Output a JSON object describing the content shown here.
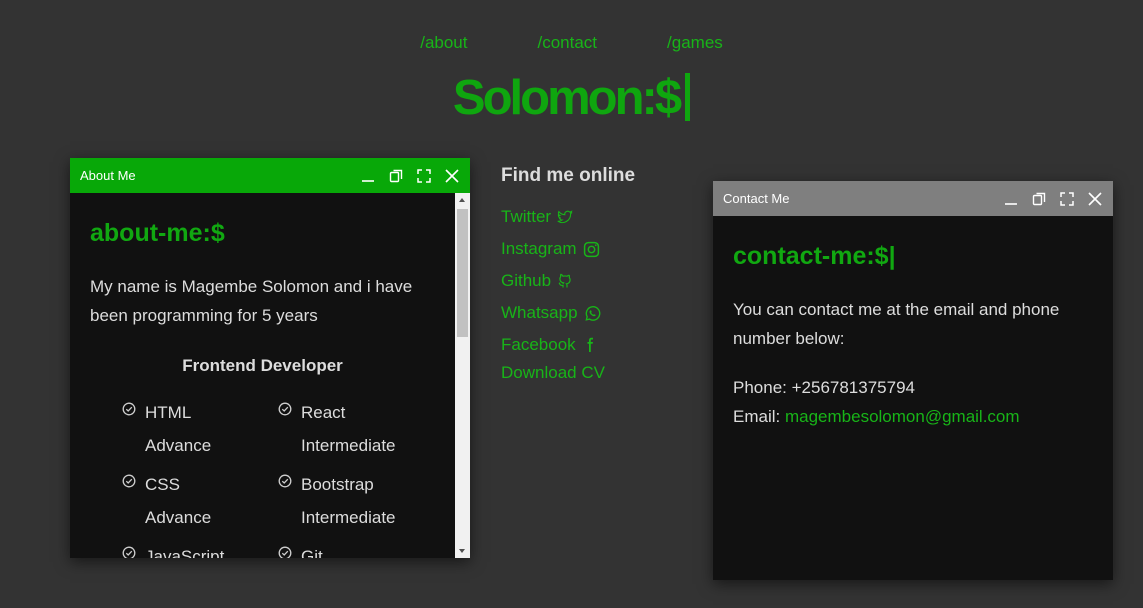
{
  "nav": {
    "about": "/about",
    "contact": "/contact",
    "games": "/games"
  },
  "brand": {
    "text": "Solomon:$"
  },
  "about_window": {
    "title": "About Me",
    "heading": "about-me:$",
    "paragraph": "My name is Magembe Solomon and i have been programming for 5 years",
    "role": "Frontend Developer",
    "skills": [
      {
        "name": "HTML",
        "level": "Advance"
      },
      {
        "name": "React",
        "level": "Intermediate"
      },
      {
        "name": "CSS",
        "level": "Advance"
      },
      {
        "name": "Bootstrap",
        "level": "Intermediate"
      },
      {
        "name": "JavaScript",
        "level": ""
      },
      {
        "name": "Git",
        "level": ""
      }
    ]
  },
  "find_online": {
    "heading": "Find me online",
    "links": [
      {
        "label": "Twitter",
        "icon": "twitter-icon"
      },
      {
        "label": "Instagram",
        "icon": "instagram-icon"
      },
      {
        "label": "Github",
        "icon": "github-icon"
      },
      {
        "label": "Whatsapp",
        "icon": "whatsapp-icon"
      },
      {
        "label": "Facebook",
        "icon": "facebook-icon"
      },
      {
        "label": "Download CV",
        "icon": ""
      }
    ]
  },
  "contact_window": {
    "title": "Contact Me",
    "heading": "contact-me:$|",
    "paragraph": "You can contact me at the email and phone number below:",
    "phone": "Phone: +256781375794",
    "email_label": "Email: ",
    "email": "magembesolomon@gmail.com"
  },
  "colors": {
    "accent": "#0fa60f",
    "link": "#18b418",
    "background": "#333333",
    "panel": "#111111",
    "contact_titlebar": "#7f7f7f"
  }
}
